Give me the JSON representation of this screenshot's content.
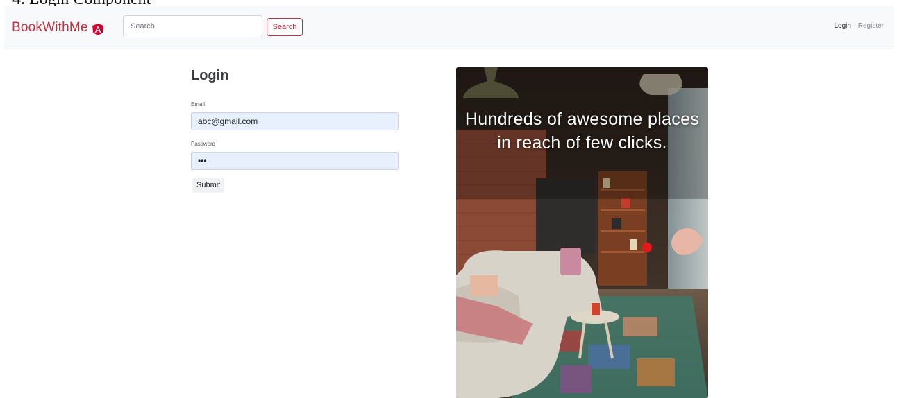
{
  "document": {
    "caption": "4. Login Component"
  },
  "navbar": {
    "brand": "BookWithMe",
    "brand_logo_icon": "angular-logo-icon",
    "search": {
      "placeholder": "Search",
      "value": ""
    },
    "search_button": "Search",
    "links": {
      "login": "Login",
      "register": "Register"
    },
    "colors": {
      "brand": "#c62d3f",
      "background": "#f8f9fa"
    }
  },
  "login": {
    "title": "Login",
    "email": {
      "label": "Email",
      "value": "abc@gmail.com"
    },
    "password": {
      "label": "Password",
      "value": "abc"
    },
    "submit": "Submit",
    "colors": {
      "autofill": "#e8f0fe"
    }
  },
  "hero": {
    "text": "Hundreds of awesome places in reach of few clicks.",
    "image": "living-room-photo"
  }
}
